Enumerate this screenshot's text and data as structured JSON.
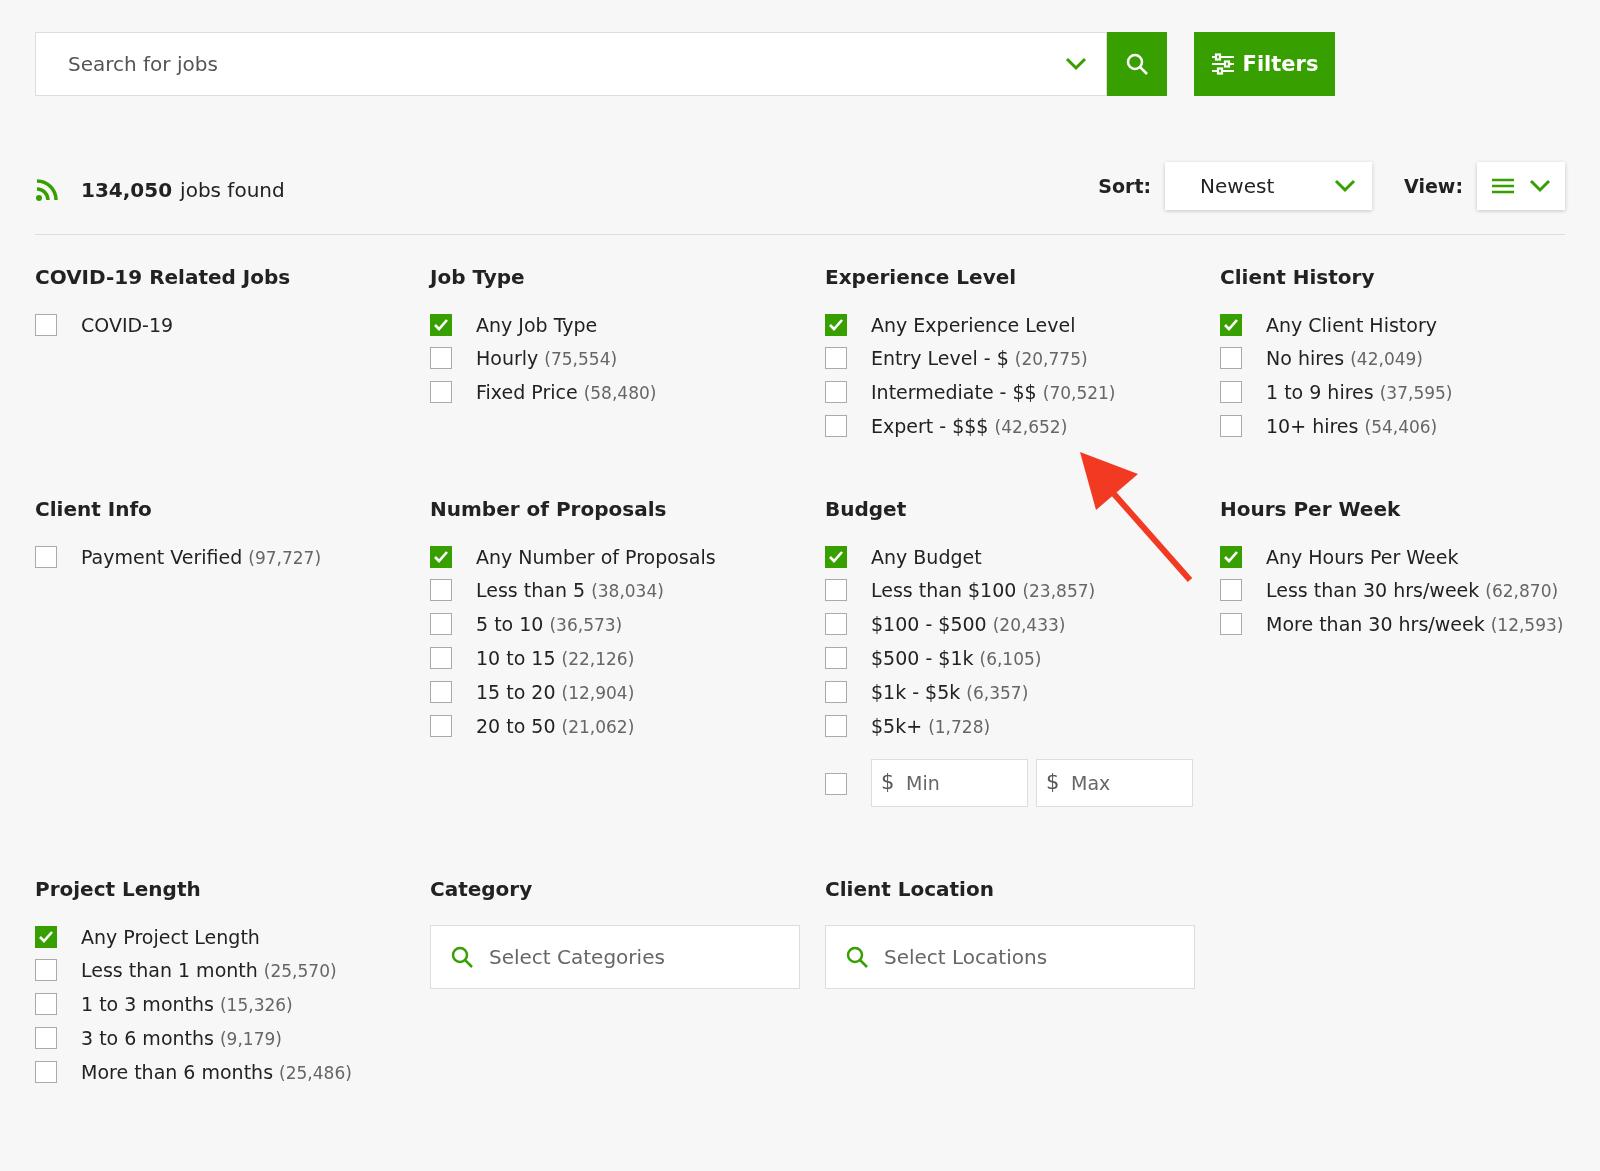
{
  "search": {
    "placeholder": "Search for jobs"
  },
  "filters_button": {
    "label": "Filters"
  },
  "results": {
    "count": "134,050",
    "label": "jobs found"
  },
  "sort": {
    "label": "Sort:",
    "value": "Newest"
  },
  "view": {
    "label": "View:"
  },
  "filter_groups": [
    {
      "title": "COVID-19 Related Jobs",
      "kind": "checklist",
      "options": [
        {
          "label": "COVID-19",
          "checked": false
        }
      ]
    },
    {
      "title": "Job Type",
      "kind": "checklist",
      "options": [
        {
          "label": "Any Job Type",
          "checked": true
        },
        {
          "label": "Hourly",
          "count": "(75,554)",
          "checked": false
        },
        {
          "label": "Fixed Price",
          "count": "(58,480)",
          "checked": false
        }
      ]
    },
    {
      "title": "Experience Level",
      "kind": "checklist",
      "options": [
        {
          "label": "Any Experience Level",
          "checked": true
        },
        {
          "label": "Entry Level - $",
          "count": "(20,775)",
          "checked": false
        },
        {
          "label": "Intermediate - $$",
          "count": "(70,521)",
          "checked": false
        },
        {
          "label": "Expert - $$$",
          "count": "(42,652)",
          "checked": false
        }
      ]
    },
    {
      "title": "Client History",
      "kind": "checklist",
      "options": [
        {
          "label": "Any Client History",
          "checked": true
        },
        {
          "label": "No hires",
          "count": "(42,049)",
          "checked": false
        },
        {
          "label": "1 to 9 hires",
          "count": "(37,595)",
          "checked": false
        },
        {
          "label": "10+ hires",
          "count": "(54,406)",
          "checked": false
        }
      ]
    },
    {
      "title": "Client Info",
      "kind": "checklist",
      "options": [
        {
          "label": "Payment Verified",
          "count": "(97,727)",
          "checked": false
        }
      ]
    },
    {
      "title": "Number of Proposals",
      "kind": "checklist",
      "options": [
        {
          "label": "Any Number of Proposals",
          "checked": true
        },
        {
          "label": "Less than 5",
          "count": "(38,034)",
          "checked": false
        },
        {
          "label": "5 to 10",
          "count": "(36,573)",
          "checked": false
        },
        {
          "label": "10 to 15",
          "count": "(22,126)",
          "checked": false
        },
        {
          "label": "15 to 20",
          "count": "(12,904)",
          "checked": false
        },
        {
          "label": "20 to 50",
          "count": "(21,062)",
          "checked": false
        }
      ]
    },
    {
      "title": "Budget",
      "kind": "checklist",
      "options": [
        {
          "label": "Any Budget",
          "checked": true
        },
        {
          "label": "Less than $100",
          "count": "(23,857)",
          "checked": false
        },
        {
          "label": "$100 - $500",
          "count": "(20,433)",
          "checked": false
        },
        {
          "label": "$500 - $1k",
          "count": "(6,105)",
          "checked": false
        },
        {
          "label": "$1k - $5k",
          "count": "(6,357)",
          "checked": false
        },
        {
          "label": "$5k+",
          "count": "(1,728)",
          "checked": false
        }
      ],
      "range": {
        "checked": false,
        "currency": "$",
        "min_placeholder": "Min",
        "max_placeholder": "Max"
      }
    },
    {
      "title": "Hours Per Week",
      "kind": "checklist",
      "options": [
        {
          "label": "Any Hours Per Week",
          "checked": true
        },
        {
          "label": "Less than 30 hrs/week",
          "count": "(62,870)",
          "checked": false
        },
        {
          "label": "More than 30 hrs/week",
          "count": "(12,593)",
          "checked": false
        }
      ]
    },
    {
      "title": "Project Length",
      "kind": "checklist",
      "options": [
        {
          "label": "Any Project Length",
          "checked": true
        },
        {
          "label": "Less than 1 month",
          "count": "(25,570)",
          "checked": false
        },
        {
          "label": "1 to 3 months",
          "count": "(15,326)",
          "checked": false
        },
        {
          "label": "3 to 6 months",
          "count": "(9,179)",
          "checked": false
        },
        {
          "label": "More than 6 months",
          "count": "(25,486)",
          "checked": false
        }
      ]
    },
    {
      "title": "Category",
      "kind": "select",
      "placeholder": "Select Categories"
    },
    {
      "title": "Client Location",
      "kind": "select",
      "placeholder": "Select Locations"
    }
  ]
}
